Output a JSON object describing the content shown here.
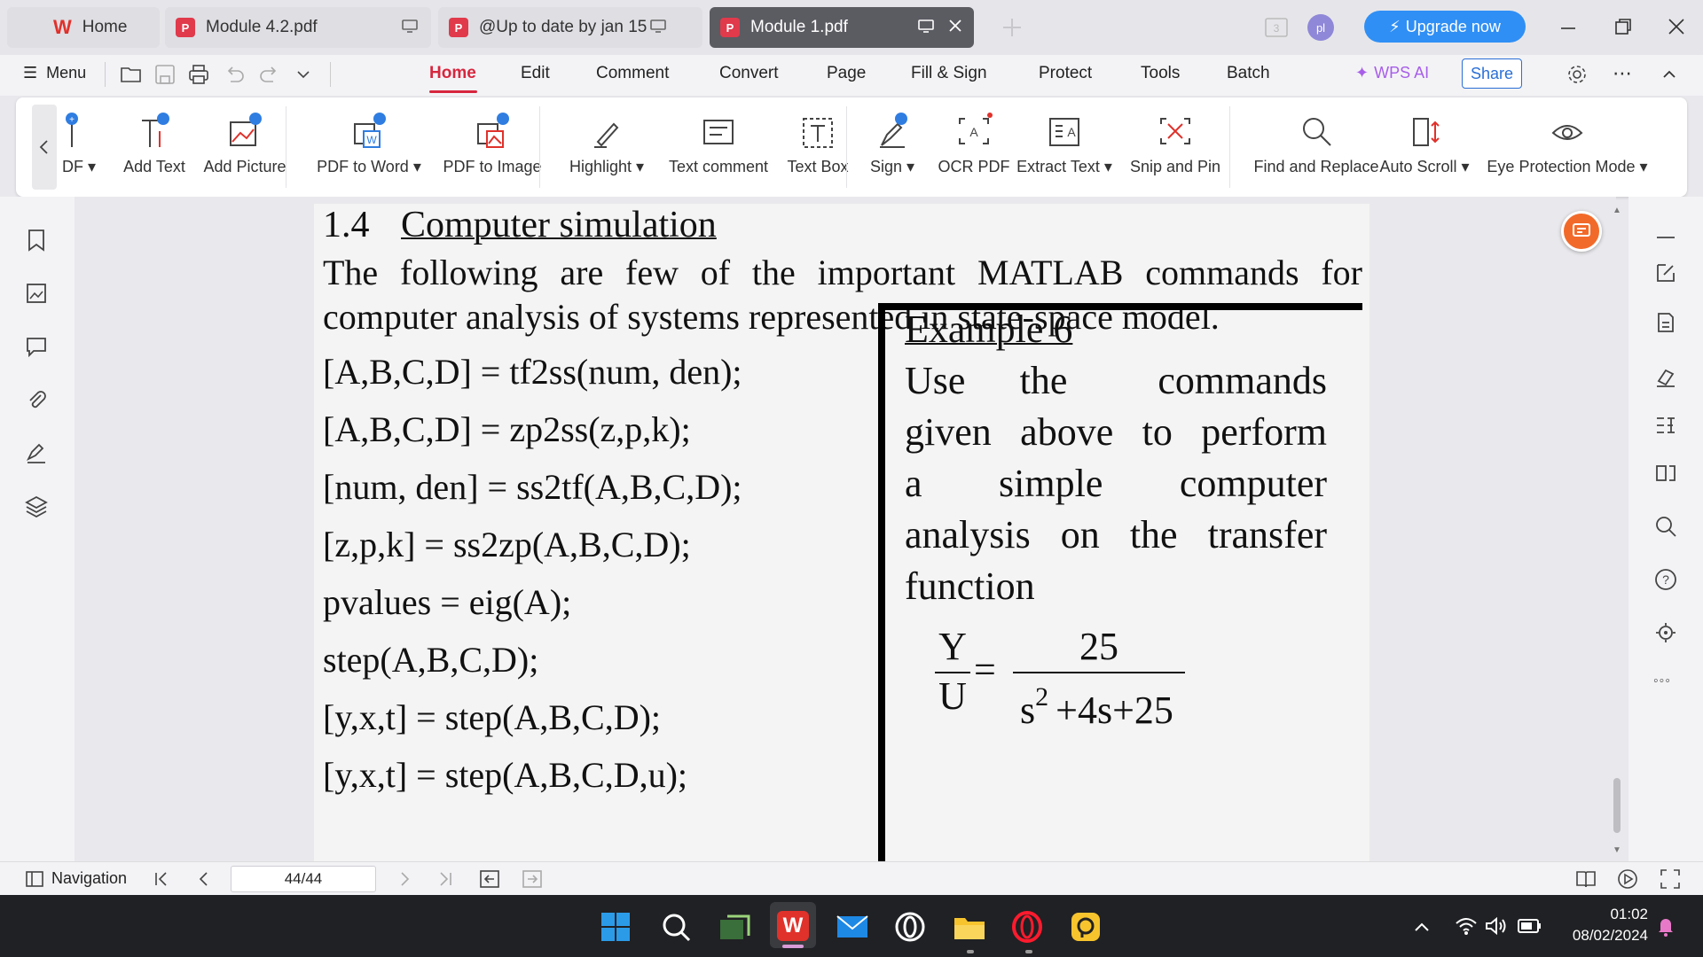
{
  "tabs": {
    "home": "Home",
    "items": [
      {
        "label": "Module 4.2.pdf"
      },
      {
        "label": "@Up to date by jan 15"
      },
      {
        "label": "Module 1.pdf"
      }
    ],
    "avatar": "pl",
    "upgrade": "Upgrade now"
  },
  "menubar": {
    "menu": "Menu",
    "items": [
      "Home",
      "Edit",
      "Comment",
      "Convert",
      "Page",
      "Fill & Sign",
      "Protect",
      "Tools",
      "Batch"
    ],
    "wps_ai": "WPS AI",
    "share": "Share"
  },
  "ribbon": {
    "items": [
      {
        "label": "DF",
        "icon": "edit-pdf-icon",
        "dropdown": true
      },
      {
        "label": "Add Text",
        "icon": "add-text-icon"
      },
      {
        "label": "Add Picture",
        "icon": "add-picture-icon"
      },
      {
        "label": "PDF to Word",
        "icon": "pdf-to-word-icon",
        "dropdown": true
      },
      {
        "label": "PDF to Image",
        "icon": "pdf-to-image-icon"
      },
      {
        "label": "Highlight",
        "icon": "highlight-icon",
        "dropdown": true
      },
      {
        "label": "Text comment",
        "icon": "text-comment-icon"
      },
      {
        "label": "Text Box",
        "icon": "text-box-icon"
      },
      {
        "label": "Sign",
        "icon": "sign-icon",
        "dropdown": true
      },
      {
        "label": "OCR PDF",
        "icon": "ocr-icon"
      },
      {
        "label": "Extract Text",
        "icon": "extract-text-icon",
        "dropdown": true
      },
      {
        "label": "Snip and Pin",
        "icon": "snip-pin-icon"
      },
      {
        "label": "Find and Replace",
        "icon": "find-replace-icon"
      },
      {
        "label": "Auto Scroll",
        "icon": "auto-scroll-icon",
        "dropdown": true
      },
      {
        "label": "Eye Protection Mode",
        "icon": "eye-icon",
        "dropdown": true
      }
    ]
  },
  "document": {
    "section_number": "1.4",
    "section_title": "Computer simulation",
    "intro_line1": "The following are few of the important MATLAB commands for",
    "intro_line2": "computer analysis of systems represented in state-space model.",
    "commands": [
      "[A,B,C,D] = tf2ss(num, den);",
      "[A,B,C,D] = zp2ss(z,p,k);",
      "[num, den] = ss2tf(A,B,C,D);",
      "[z,p,k] = ss2zp(A,B,C,D);",
      "pvalues = eig(A);",
      "step(A,B,C,D);",
      "[y,x,t] = step(A,B,C,D);",
      "[y,x,t] = step(A,B,C,D,u);"
    ],
    "example_title": "Example 6",
    "example_lines": [
      "Use   the     commands",
      "given above to perform",
      "a   simple   computer",
      "analysis on the transfer",
      "function"
    ],
    "formula": {
      "lhs_num": "Y",
      "lhs_den": "U",
      "eq": "=",
      "rhs_num": "25",
      "rhs_den_a": "s",
      "rhs_den_exp": "2",
      "rhs_den_b": "+4s+25"
    }
  },
  "navigation": {
    "label": "Navigation",
    "page": "44/44"
  },
  "taskbar": {
    "time": "01:02",
    "date": "08/02/2024"
  },
  "colors": {
    "accent": "#d7263d",
    "upgrade": "#2f8ff5",
    "wps_ai": "#a75ee8",
    "share": "#2a6fd6",
    "float_button": "#f26a2a"
  }
}
